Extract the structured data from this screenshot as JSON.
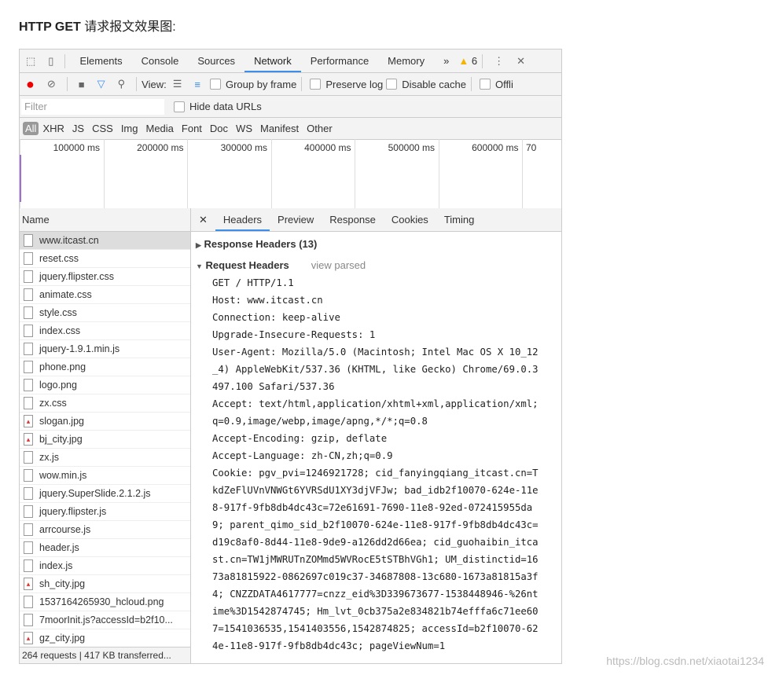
{
  "heading": {
    "bold": "HTTP GET",
    "rest": " 请求报文效果图:"
  },
  "tabs": [
    "Elements",
    "Console",
    "Sources",
    "Network",
    "Performance",
    "Memory"
  ],
  "active_tab": "Network",
  "warnings": "6",
  "toolbar": {
    "view_label": "View:",
    "group_by_frame": "Group by frame",
    "preserve_log": "Preserve log",
    "disable_cache": "Disable cache",
    "offline": "Offli"
  },
  "filter": {
    "placeholder": "Filter",
    "hide_data_urls": "Hide data URLs"
  },
  "types": [
    "All",
    "XHR",
    "JS",
    "CSS",
    "Img",
    "Media",
    "Font",
    "Doc",
    "WS",
    "Manifest",
    "Other"
  ],
  "timeline": [
    "100000 ms",
    "200000 ms",
    "300000 ms",
    "400000 ms",
    "500000 ms",
    "600000 ms",
    "70"
  ],
  "list": {
    "header": "Name",
    "items": [
      "www.itcast.cn",
      "reset.css",
      "jquery.flipster.css",
      "animate.css",
      "style.css",
      "index.css",
      "jquery-1.9.1.min.js",
      "phone.png",
      "logo.png",
      "zx.css",
      "slogan.jpg",
      "bj_city.jpg",
      "zx.js",
      "wow.min.js",
      "jquery.SuperSlide.2.1.2.js",
      "jquery.flipster.js",
      "arrcourse.js",
      "header.js",
      "index.js",
      "sh_city.jpg",
      "1537164265930_hcloud.png",
      "7moorInit.js?accessId=b2f10...",
      "gz_city.jpg"
    ],
    "status": "264 requests | 417 KB transferred..."
  },
  "detail": {
    "tabs": [
      "Headers",
      "Preview",
      "Response",
      "Cookies",
      "Timing"
    ],
    "response_headers": "Response Headers (13)",
    "request_headers": "Request Headers",
    "view_parsed": "view parsed",
    "lines": [
      "GET / HTTP/1.1",
      "Host: www.itcast.cn",
      "Connection: keep-alive",
      "Upgrade-Insecure-Requests: 1",
      "User-Agent: Mozilla/5.0 (Macintosh; Intel Mac OS X 10_12",
      "_4) AppleWebKit/537.36 (KHTML, like Gecko) Chrome/69.0.3",
      "497.100 Safari/537.36",
      "Accept: text/html,application/xhtml+xml,application/xml;",
      "q=0.9,image/webp,image/apng,*/*;q=0.8",
      "Accept-Encoding: gzip, deflate",
      "Accept-Language: zh-CN,zh;q=0.9",
      "Cookie: pgv_pvi=1246921728; cid_fanyingqiang_itcast.cn=T",
      "kdZeFlUVnVNWGt6YVRSdU1XY3djVFJw; bad_idb2f10070-624e-11e",
      "8-917f-9fb8db4dc43c=72e61691-7690-11e8-92ed-072415955da",
      "9; parent_qimo_sid_b2f10070-624e-11e8-917f-9fb8db4dc43c=",
      "d19c8af0-8d44-11e8-9de9-a126dd2d66ea; cid_guohaibin_itca",
      "st.cn=TW1jMWRUTnZOMmd5WVRocE5tSTBhVGh1; UM_distinctid=16",
      "73a81815922-0862697c019c37-34687808-13c680-1673a81815a3f",
      "4; CNZZDATA4617777=cnzz_eid%3D339673677-1538448946-%26nt",
      "ime%3D1542874745; Hm_lvt_0cb375a2e834821b74efffa6c71ee60",
      "7=1541036535,1541403556,1542874825; accessId=b2f10070-62",
      "4e-11e8-917f-9fb8db4dc43c; pageViewNum=1"
    ]
  },
  "watermark": "https://blog.csdn.net/xiaotai1234"
}
